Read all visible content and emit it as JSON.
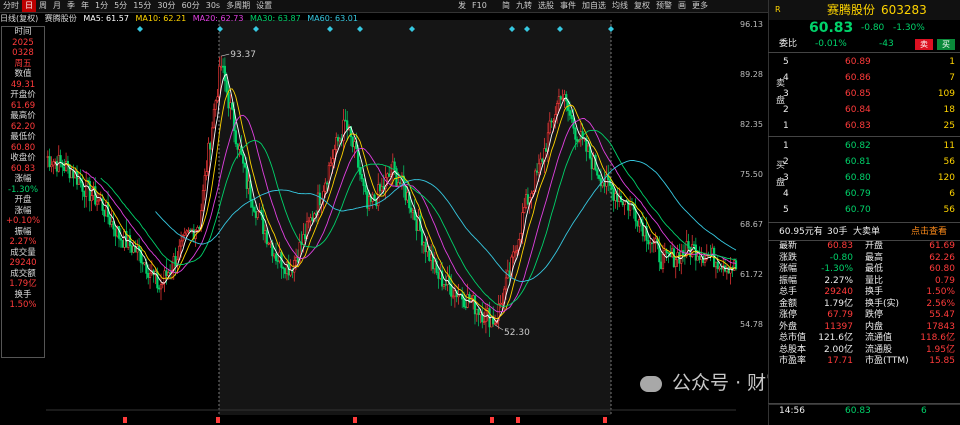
{
  "toolbar": {
    "left_items": [
      "分时",
      "日",
      "周",
      "月",
      "季",
      "年",
      "1分",
      "5分",
      "15分",
      "30分",
      "60分",
      "30s",
      "多周期",
      "设置"
    ],
    "active": "日",
    "right_items": [
      "发",
      "F10",
      "简",
      "九转",
      "选股",
      "事件",
      "加自选",
      "均线",
      "复权",
      "预警",
      "画",
      "更多"
    ]
  },
  "ma_bar": {
    "prefix": "日线(复权)",
    "name": "赛腾股份",
    "ma5": "MA5: 61.57",
    "ma10": "MA10: 62.21",
    "ma20": "MA20: 62.73",
    "ma30": "MA30: 63.87",
    "ma60": "MA60: 63.01"
  },
  "info_panel": {
    "rows": [
      {
        "label": "时间",
        "value": "2025"
      },
      {
        "label": "",
        "value": "0328"
      },
      {
        "label": "",
        "value": "周五"
      },
      {
        "label": "数值",
        "value": "49.31"
      },
      {
        "label": "开盘价",
        "value": "61.69"
      },
      {
        "label": "最高价",
        "value": "62.20"
      },
      {
        "label": "最低价",
        "value": "60.80"
      },
      {
        "label": "收盘价",
        "value": "60.83"
      },
      {
        "label": "涨幅",
        "value": "-1.30%"
      },
      {
        "label": "开盘",
        "value": ""
      },
      {
        "label": "涨幅",
        "value": "+0.10%"
      },
      {
        "label": "振幅",
        "value": "2.27%"
      },
      {
        "label": "成交量",
        "value": "29240"
      },
      {
        "label": "成交额",
        "value": "1.79亿"
      },
      {
        "label": "换手",
        "value": "1.50%"
      }
    ]
  },
  "price_axis": [
    "96.13",
    "89.28",
    "82.35",
    "75.50",
    "68.67",
    "61.72",
    "54.78"
  ],
  "annotations": {
    "high": "93.37",
    "low": "52.30"
  },
  "quote": {
    "title": "赛腾股份",
    "code": "603283",
    "price": "60.83",
    "change": "-0.80",
    "change_pct": "-1.30%",
    "weibi_label": "委比",
    "weibi": "-0.01%",
    "weicha": "-43",
    "sell_label": "卖",
    "buy_label": "买",
    "sell_side_label": "卖盘",
    "buy_side_label": "买盘",
    "asks": [
      {
        "lvl": "5",
        "price": "60.89",
        "vol": "1"
      },
      {
        "lvl": "4",
        "price": "60.86",
        "vol": "7"
      },
      {
        "lvl": "3",
        "price": "60.85",
        "vol": "109"
      },
      {
        "lvl": "2",
        "price": "60.84",
        "vol": "18"
      },
      {
        "lvl": "1",
        "price": "60.83",
        "vol": "25"
      }
    ],
    "bids": [
      {
        "lvl": "1",
        "price": "60.82",
        "vol": "11"
      },
      {
        "lvl": "2",
        "price": "60.81",
        "vol": "56"
      },
      {
        "lvl": "3",
        "price": "60.80",
        "vol": "120"
      },
      {
        "lvl": "4",
        "price": "60.79",
        "vol": "6"
      },
      {
        "lvl": "5",
        "price": "60.70",
        "vol": "56"
      }
    ],
    "big_order": "60.95元有",
    "big_order_vol": "30手",
    "big_order_tag": "大卖单",
    "big_order_link": "点击查看",
    "stats": [
      {
        "l1": "最新",
        "v1": "60.83",
        "l2": "开盘",
        "v2": "61.69"
      },
      {
        "l1": "涨跌",
        "v1": "-0.80",
        "l2": "最高",
        "v2": "62.26"
      },
      {
        "l1": "涨幅",
        "v1": "-1.30%",
        "l2": "最低",
        "v2": "60.80"
      },
      {
        "l1": "振幅",
        "v1": "2.27%",
        "l2": "量比",
        "v2": "0.79"
      },
      {
        "l1": "总手",
        "v1": "29240",
        "l2": "换手",
        "v2": "1.50%"
      },
      {
        "l1": "金额",
        "v1": "1.79亿",
        "l2": "换手(实)",
        "v2": "2.56%"
      },
      {
        "l1": "涨停",
        "v1": "67.79",
        "l2": "跌停",
        "v2": "55.47"
      },
      {
        "l1": "外盘",
        "v1": "11397",
        "l2": "内盘",
        "v2": "17843"
      },
      {
        "l1": "总市值",
        "v1": "121.6亿",
        "l2": "流通值",
        "v2": "118.6亿"
      },
      {
        "l1": "总股本",
        "v1": "2.00亿",
        "l2": "流通股",
        "v2": "1.95亿"
      },
      {
        "l1": "市盈率",
        "v1": "17.71",
        "l2": "市盈(TTM)",
        "v2": "15.85"
      }
    ],
    "ticks": [
      {
        "time": "14:56",
        "price": "60.83",
        "vol": "6"
      }
    ]
  },
  "watermark": "公众号 · 财富独角兽",
  "colors": {
    "up": "#ff3b3b",
    "down": "#00d26a",
    "ma5": "#ffffff",
    "ma10": "#ffd400",
    "ma20": "#e040e0",
    "ma30": "#00d26a",
    "ma60": "#36c8e0"
  }
}
